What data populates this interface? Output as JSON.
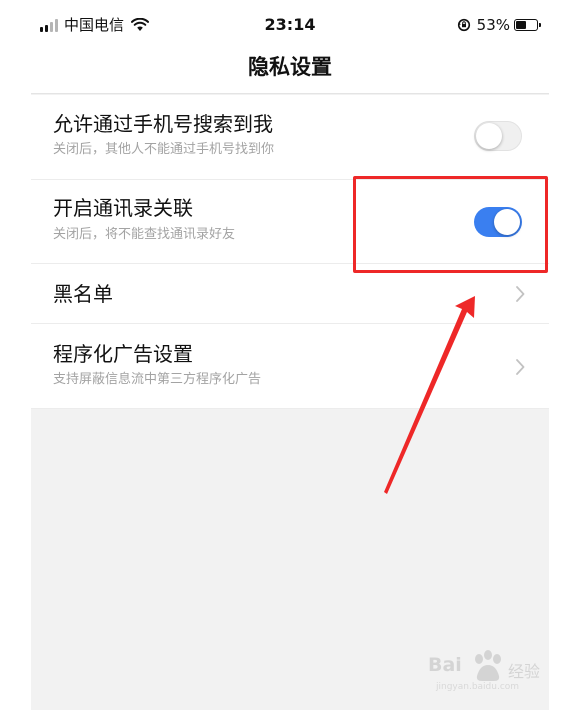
{
  "status_bar": {
    "carrier": "中国电信",
    "time": "23:14",
    "battery": "53%",
    "battery_level": 0.53,
    "signal_bars": 4,
    "signal_active": 2
  },
  "header": {
    "title": "隐私设置"
  },
  "settings": [
    {
      "title": "允许通过手机号搜索到我",
      "subtitle": "关闭后，其他人不能通过手机号找到你",
      "control": "toggle",
      "on": false
    },
    {
      "title": "开启通讯录关联",
      "subtitle": "关闭后，将不能查找通讯录好友",
      "control": "toggle",
      "on": true
    },
    {
      "title": "黑名单",
      "control": "chevron"
    },
    {
      "title": "程序化广告设置",
      "subtitle": "支持屏蔽信息流中第三方程序化广告",
      "control": "chevron"
    }
  ],
  "icons": {
    "signal": "signal-icon",
    "wifi": "wifi-icon",
    "orientation_lock": "orientation-lock-icon",
    "battery": "battery-icon",
    "toggle": "toggle-switch",
    "chevron": "chevron-right-icon",
    "watermark_logo": "baidu-paw-icon"
  },
  "colors": {
    "accent_toggle_on": "#3a7ff0",
    "annotation_red": "#ee2828",
    "subtitle_gray": "#a3a3a3",
    "background": "#f2f2f2"
  },
  "watermark": {
    "brand": "Bai",
    "product": "经验",
    "url": "jingyan.baidu.com"
  }
}
